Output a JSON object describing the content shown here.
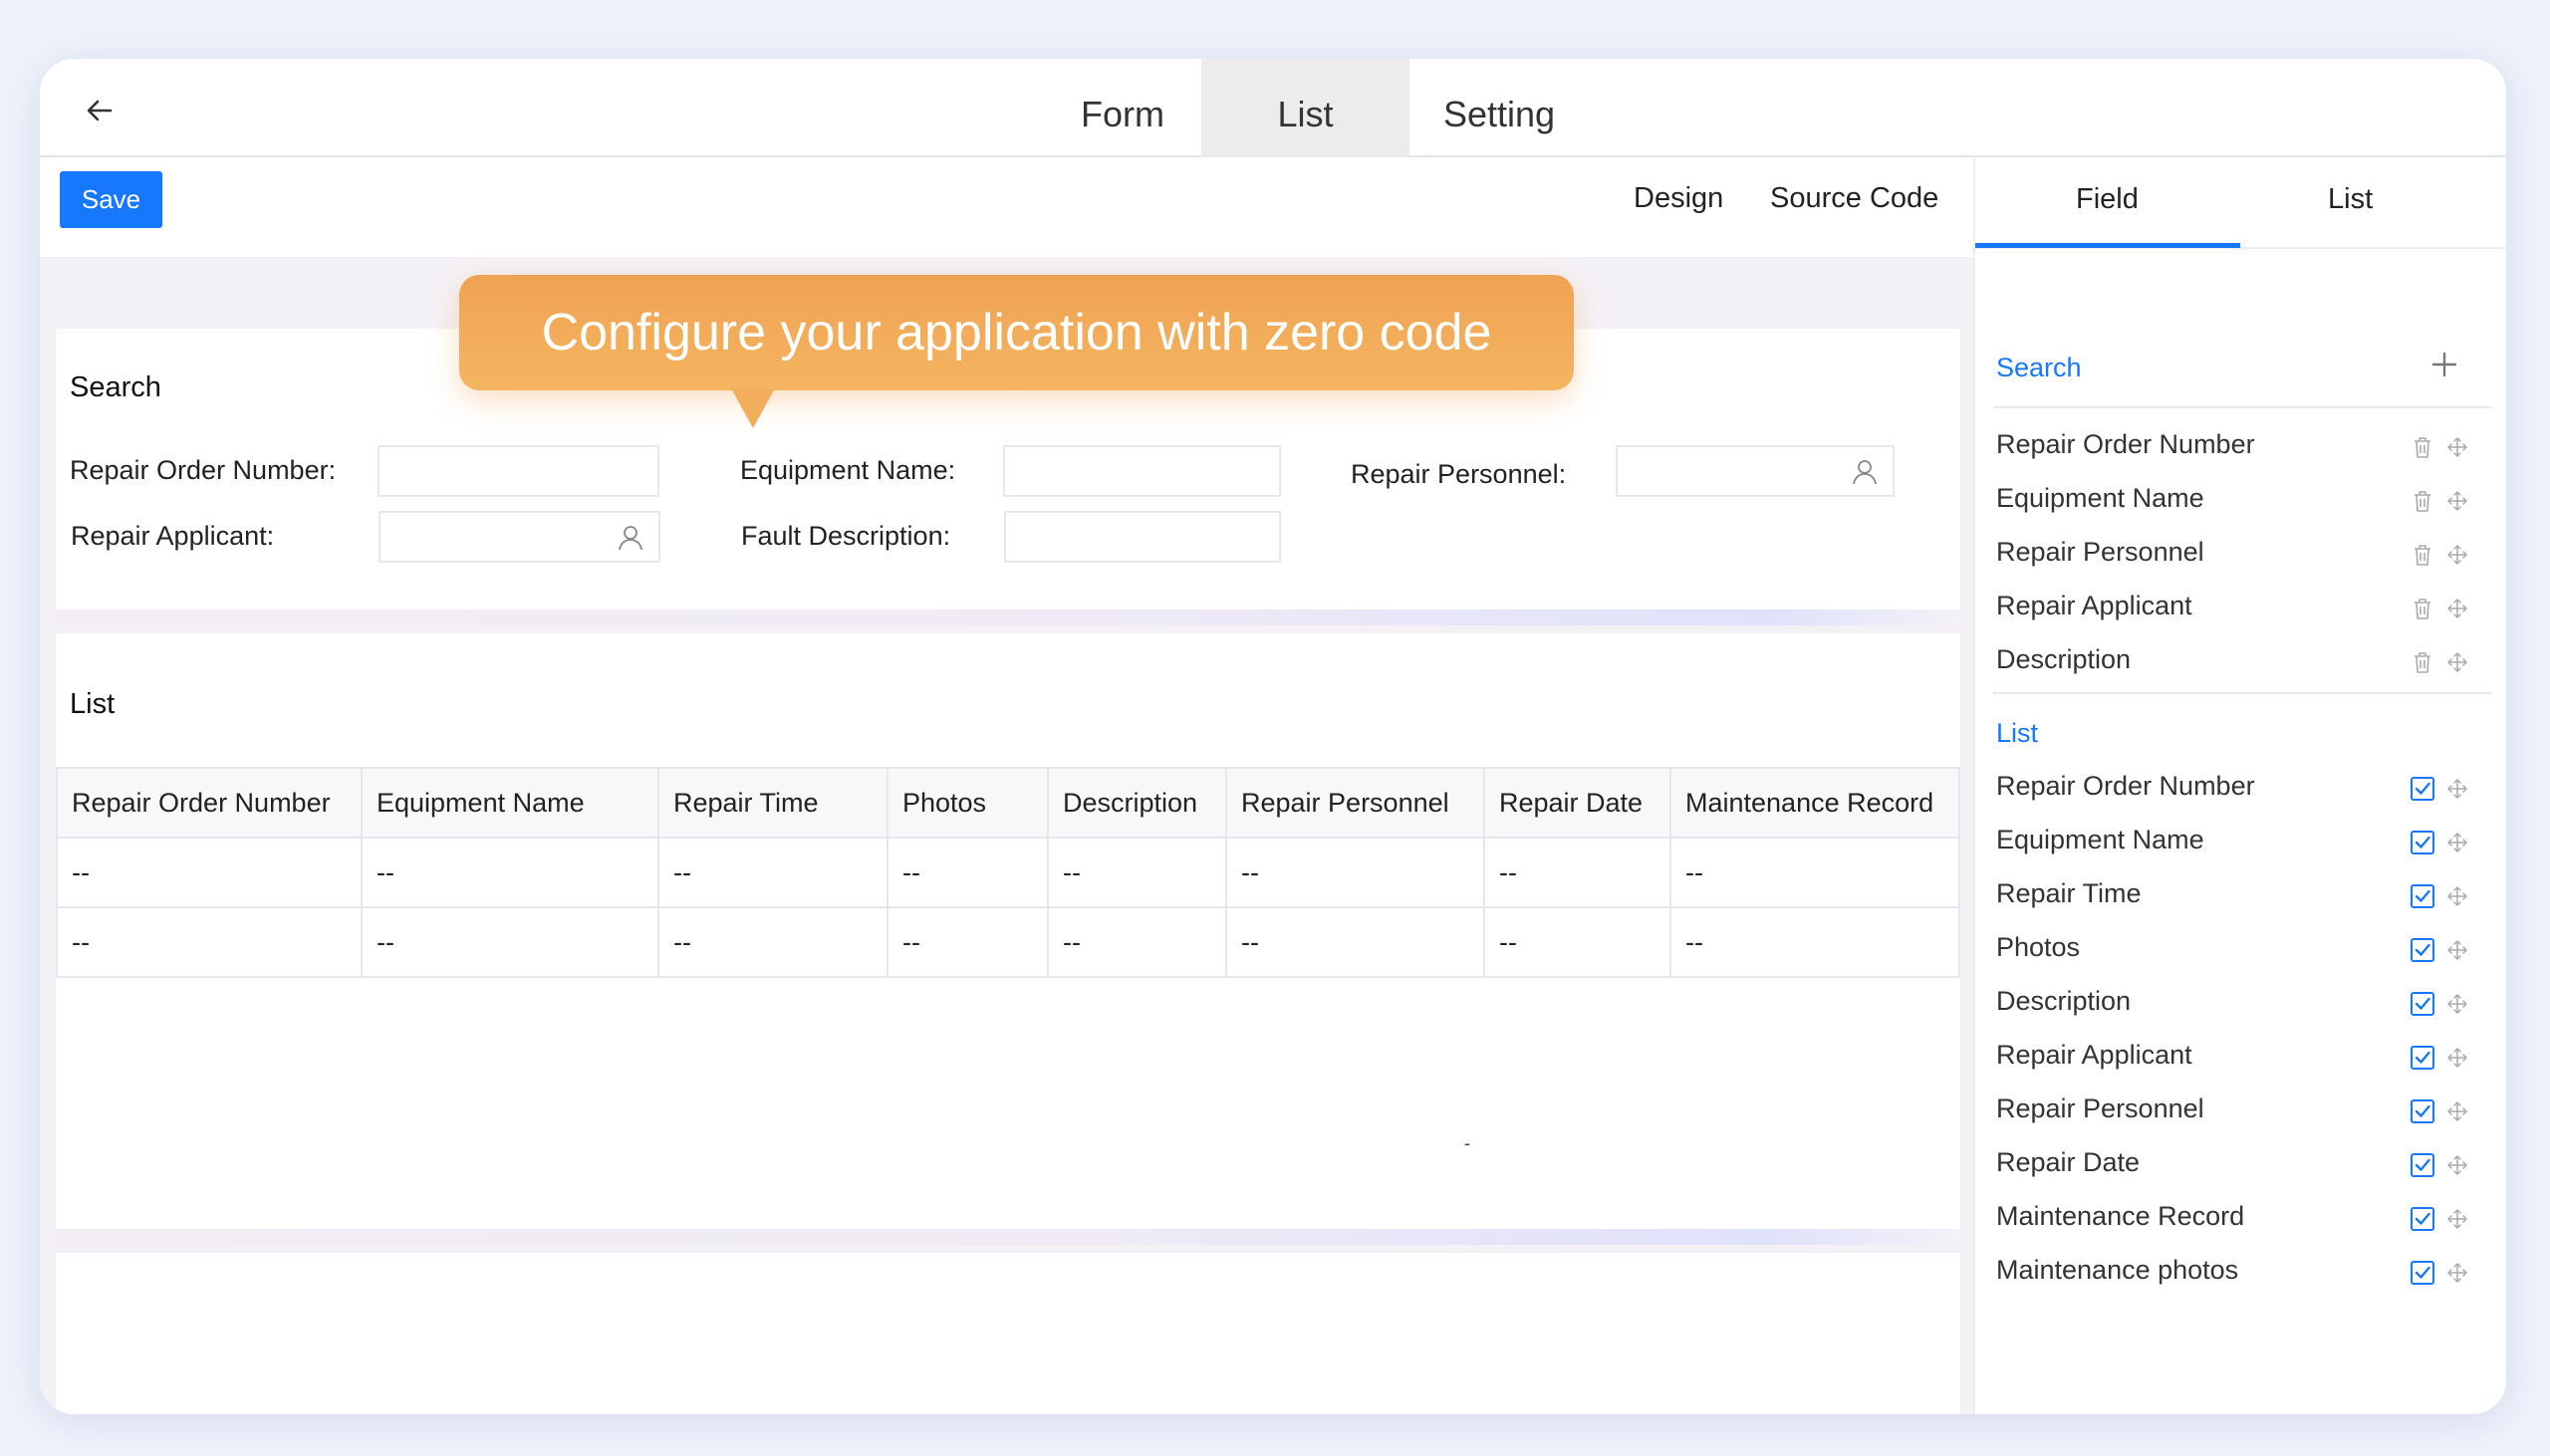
{
  "nav": {
    "tabs": [
      {
        "label": "Form"
      },
      {
        "label": "List"
      },
      {
        "label": "Setting"
      }
    ],
    "active_tab": "List"
  },
  "toolbar": {
    "save_label": "Save",
    "design_label": "Design",
    "source_code_label": "Source Code"
  },
  "callout": {
    "text": "Configure your application with zero code"
  },
  "search_panel": {
    "title": "Search",
    "fields": [
      {
        "label": "Repair Order Number:",
        "value": ""
      },
      {
        "label": "Equipment Name:",
        "value": ""
      },
      {
        "label": "Repair Personnel:",
        "value": ""
      },
      {
        "label": "Repair Applicant:",
        "value": ""
      },
      {
        "label": "Fault Description:",
        "value": ""
      }
    ]
  },
  "list_panel": {
    "title": "List",
    "columns": [
      "Repair Order Number",
      "Equipment Name",
      "Repair Time",
      "Photos",
      "Description",
      "Repair Personnel",
      "Repair Date",
      "Maintenance Record"
    ],
    "rows": [
      [
        "--",
        "--",
        "--",
        "--",
        "--",
        "--",
        "--",
        "--"
      ],
      [
        "--",
        "--",
        "--",
        "--",
        "--",
        "--",
        "--",
        "--"
      ]
    ],
    "stray_mark": "-"
  },
  "sidebar": {
    "tabs": [
      {
        "label": "Field"
      },
      {
        "label": "List"
      }
    ],
    "active_tab": "Field",
    "search_section": {
      "title": "Search",
      "items": [
        "Repair Order Number",
        "Equipment Name",
        "Repair Personnel",
        "Repair Applicant",
        "Description"
      ]
    },
    "list_section": {
      "title": "List",
      "items": [
        {
          "label": "Repair Order Number",
          "checked": true
        },
        {
          "label": "Equipment Name",
          "checked": true
        },
        {
          "label": "Repair Time",
          "checked": true
        },
        {
          "label": "Photos",
          "checked": true
        },
        {
          "label": "Description",
          "checked": true
        },
        {
          "label": "Repair Applicant",
          "checked": true
        },
        {
          "label": "Repair Personnel",
          "checked": true
        },
        {
          "label": "Repair Date",
          "checked": true
        },
        {
          "label": "Maintenance Record",
          "checked": true
        },
        {
          "label": "Maintenance photos",
          "checked": true
        }
      ]
    }
  },
  "icons": {
    "back": "arrow-left-icon",
    "person": "user-icon",
    "add": "plus-icon",
    "delete": "trash-icon",
    "drag": "move-icon",
    "checkbox": "checkbox-checked-icon"
  },
  "colors": {
    "accent": "#1677ff",
    "callout": "#f2ab59",
    "frame_bg": "#eef2fb"
  }
}
